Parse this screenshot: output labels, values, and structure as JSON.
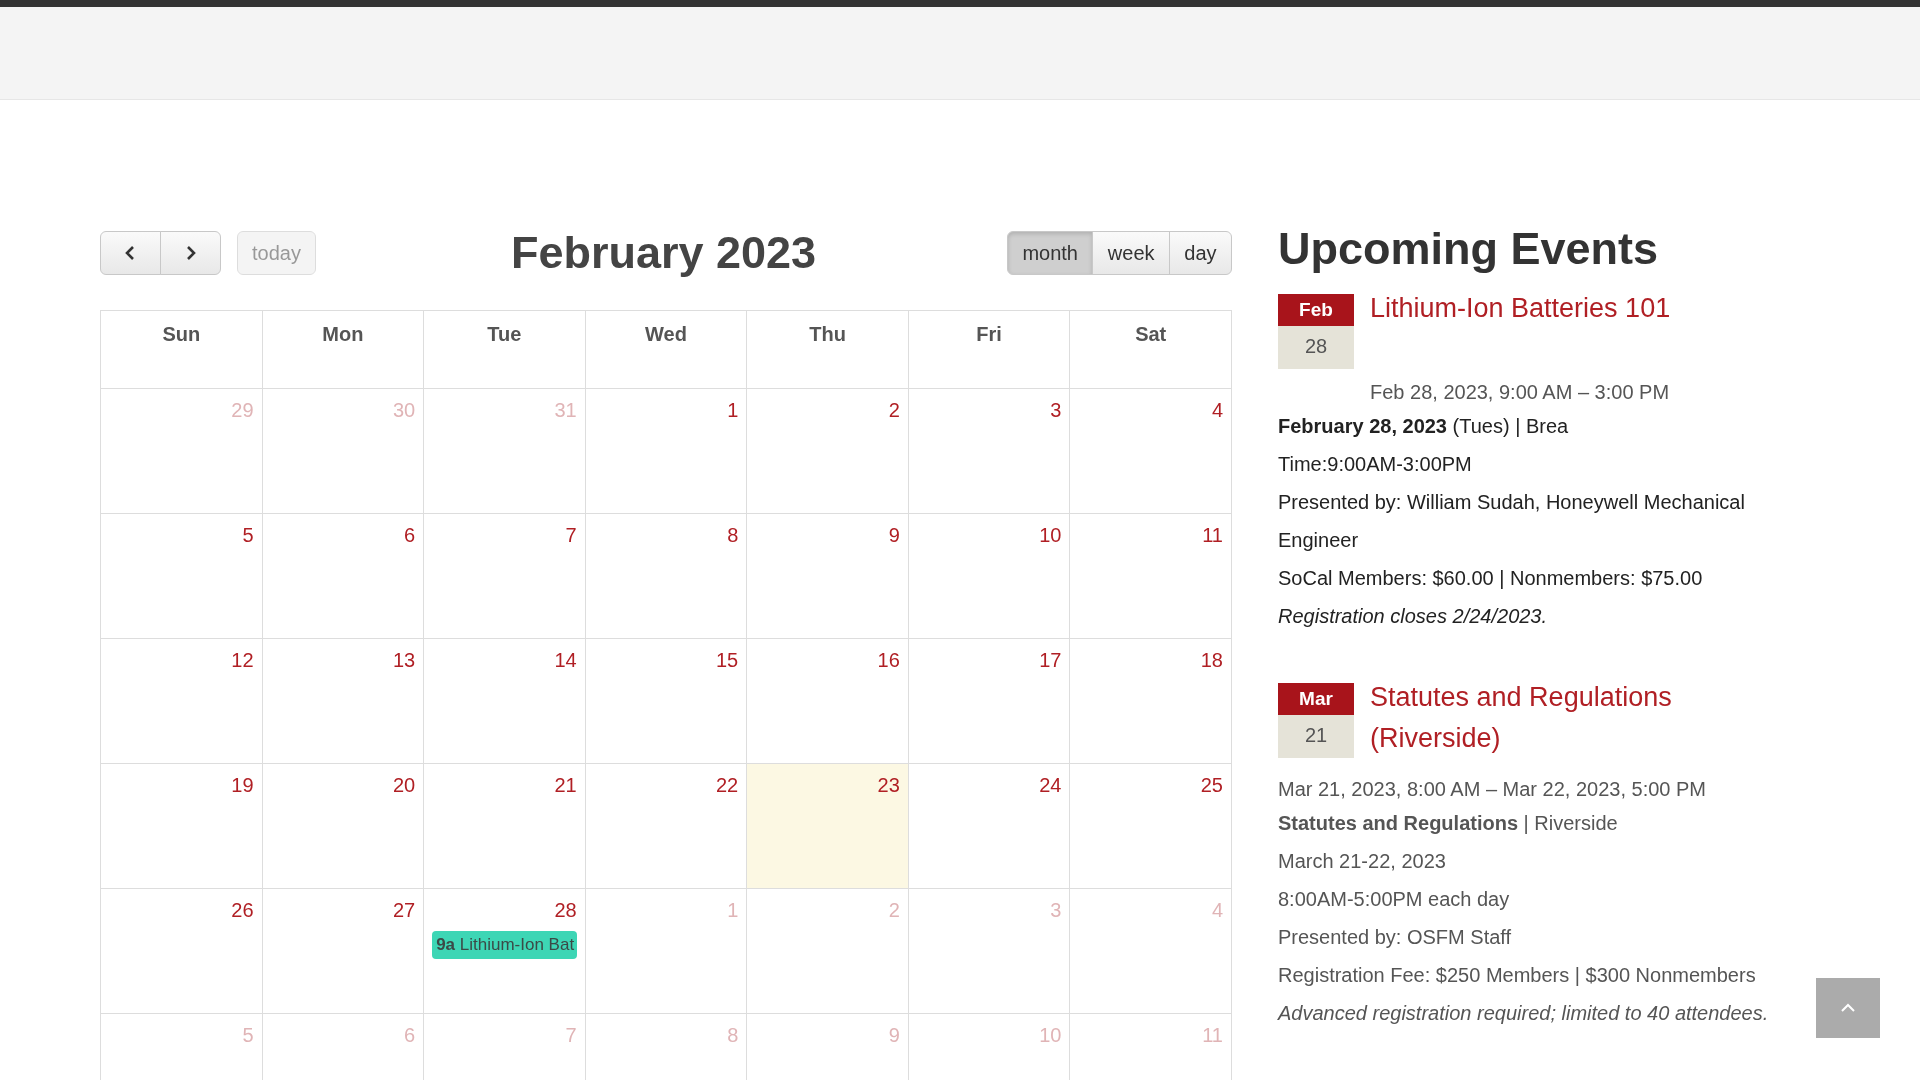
{
  "calendar": {
    "nav_buttons": [
      {
        "kind": "prev"
      },
      {
        "kind": "next"
      }
    ],
    "today_button": {
      "label": "today",
      "disabled": true
    },
    "title": "February 2023",
    "views": [
      {
        "label": "month",
        "selected": true
      },
      {
        "label": "week",
        "selected": false
      },
      {
        "label": "day",
        "selected": false
      }
    ],
    "weekdays": [
      "Sun",
      "Mon",
      "Tue",
      "Wed",
      "Thu",
      "Fri",
      "Sat"
    ],
    "weeks": [
      [
        {
          "day": "29",
          "other_month": true,
          "today": false
        },
        {
          "day": "30",
          "other_month": true,
          "today": false
        },
        {
          "day": "31",
          "other_month": true,
          "today": false
        },
        {
          "day": "1",
          "other_month": false,
          "today": false
        },
        {
          "day": "2",
          "other_month": false,
          "today": false
        },
        {
          "day": "3",
          "other_month": false,
          "today": false
        },
        {
          "day": "4",
          "other_month": false,
          "today": false
        }
      ],
      [
        {
          "day": "5",
          "other_month": false,
          "today": false
        },
        {
          "day": "6",
          "other_month": false,
          "today": false
        },
        {
          "day": "7",
          "other_month": false,
          "today": false
        },
        {
          "day": "8",
          "other_month": false,
          "today": false
        },
        {
          "day": "9",
          "other_month": false,
          "today": false
        },
        {
          "day": "10",
          "other_month": false,
          "today": false
        },
        {
          "day": "11",
          "other_month": false,
          "today": false
        }
      ],
      [
        {
          "day": "12",
          "other_month": false,
          "today": false
        },
        {
          "day": "13",
          "other_month": false,
          "today": false
        },
        {
          "day": "14",
          "other_month": false,
          "today": false
        },
        {
          "day": "15",
          "other_month": false,
          "today": false
        },
        {
          "day": "16",
          "other_month": false,
          "today": false
        },
        {
          "day": "17",
          "other_month": false,
          "today": false
        },
        {
          "day": "18",
          "other_month": false,
          "today": false
        }
      ],
      [
        {
          "day": "19",
          "other_month": false,
          "today": false
        },
        {
          "day": "20",
          "other_month": false,
          "today": false
        },
        {
          "day": "21",
          "other_month": false,
          "today": false
        },
        {
          "day": "22",
          "other_month": false,
          "today": false
        },
        {
          "day": "23",
          "other_month": false,
          "today": true
        },
        {
          "day": "24",
          "other_month": false,
          "today": false
        },
        {
          "day": "25",
          "other_month": false,
          "today": false
        }
      ],
      [
        {
          "day": "26",
          "other_month": false,
          "today": false
        },
        {
          "day": "27",
          "other_month": false,
          "today": false
        },
        {
          "day": "28",
          "other_month": false,
          "today": false,
          "events": [
            {
              "time": "9a",
              "title": "Lithium-Ion Bat",
              "color": "#3dd6b5"
            }
          ]
        },
        {
          "day": "1",
          "other_month": true,
          "today": false
        },
        {
          "day": "2",
          "other_month": true,
          "today": false
        },
        {
          "day": "3",
          "other_month": true,
          "today": false
        },
        {
          "day": "4",
          "other_month": true,
          "today": false
        }
      ],
      [
        {
          "day": "5",
          "other_month": true,
          "today": false
        },
        {
          "day": "6",
          "other_month": true,
          "today": false
        },
        {
          "day": "7",
          "other_month": true,
          "today": false
        },
        {
          "day": "8",
          "other_month": true,
          "today": false
        },
        {
          "day": "9",
          "other_month": true,
          "today": false
        },
        {
          "day": "10",
          "other_month": true,
          "today": false
        },
        {
          "day": "11",
          "other_month": true,
          "today": false
        }
      ]
    ]
  },
  "upcoming": {
    "heading": "Upcoming Events",
    "events": [
      {
        "month": "Feb",
        "day": "28",
        "title": "Lithium-Ion Batteries 101",
        "when": "Feb 28, 2023, 9:00 AM – 3:00 PM",
        "muted": false,
        "lines": [
          {
            "kind": "text",
            "text": "**February 28, 2023** (Tues) | Brea"
          },
          {
            "kind": "text",
            "text": "Time:9:00AM-3:00PM"
          },
          {
            "kind": "text",
            "text": "Presented by: William Sudah, Honeywell Mechanical Engineer"
          },
          {
            "kind": "text",
            "text": "SoCal Members: $60.00 | Nonmembers: $75.00"
          },
          {
            "kind": "note",
            "text": "Registration closes 2/24/2023."
          }
        ]
      },
      {
        "month": "Mar",
        "day": "21",
        "title": "Statutes and Regulations (Riverside)",
        "when": "Mar 21, 2023, 8:00 AM – Mar 22, 2023, 5:00 PM",
        "muted": true,
        "lines": [
          {
            "kind": "text",
            "text": "**Statutes and Regulations** | Riverside"
          },
          {
            "kind": "text",
            "text": "March 21-22, 2023"
          },
          {
            "kind": "text",
            "text": "8:00AM-5:00PM each day"
          },
          {
            "kind": "text",
            "text": "Presented by: OSFM Staff"
          },
          {
            "kind": "text",
            "text": "Registration Fee: $250 Members | $300 Nonmembers"
          },
          {
            "kind": "note",
            "text": "Advanced registration required; limited to 40 attendees."
          }
        ]
      }
    ]
  },
  "scroll_top": {
    "kind": "up"
  }
}
